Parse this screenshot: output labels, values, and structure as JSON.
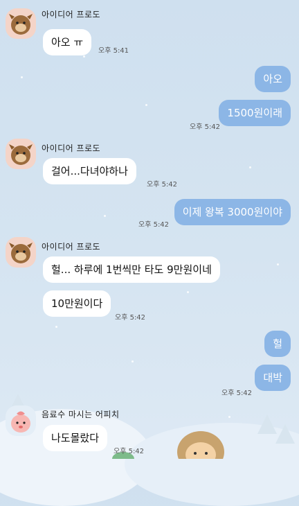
{
  "messages": [
    {
      "id": "m1",
      "sender": "아이디어 프로도",
      "text": "아오 ㅠ",
      "time": "오후 5:41",
      "dir": "in"
    },
    {
      "id": "m2",
      "text": "아오",
      "dir": "out"
    },
    {
      "id": "m3",
      "text": "1500원이래",
      "time": "오후 5:42",
      "dir": "out"
    },
    {
      "id": "m4",
      "sender": "아이디어 프로도",
      "text": "걸어...다녀야하나",
      "time": "오후 5:42",
      "dir": "in"
    },
    {
      "id": "m5",
      "text": "이제 왕복 3000원이야",
      "time": "오후 5:42",
      "dir": "out"
    },
    {
      "id": "m6",
      "sender": "아이디어 프로도",
      "text": "헐... 하루에 1번씩만 타도 9만원이네",
      "dir": "in"
    },
    {
      "id": "m7",
      "text": "10만원이다",
      "time": "오후 5:42",
      "dir": "in"
    },
    {
      "id": "m8",
      "text": "헐",
      "dir": "out"
    },
    {
      "id": "m9",
      "text": "대박",
      "time": "오후 5:42",
      "dir": "out"
    },
    {
      "id": "m10",
      "sender": "음료수 마시는 어피치",
      "text": "나도몰랐다",
      "time": "오후 5:42",
      "dir": "in"
    }
  ],
  "icons": {
    "frodo": "frodo-avatar-icon",
    "apeach": "apeach-avatar-icon"
  },
  "colors": {
    "outgoing": "#8cb6e6",
    "incoming": "#ffffff",
    "background": "#d5e4f1"
  }
}
